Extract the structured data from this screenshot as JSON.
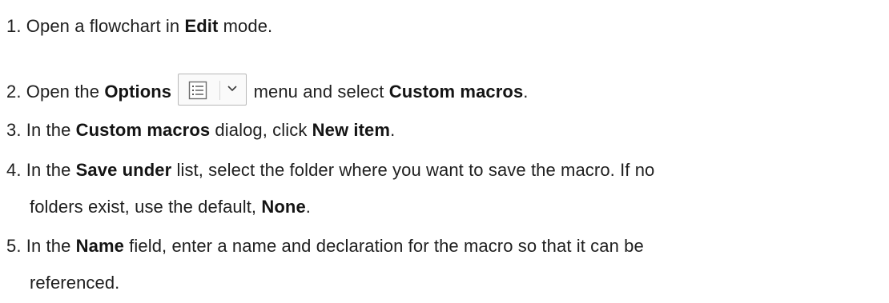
{
  "steps": [
    {
      "num": "1.",
      "t1": " Open a flowchart in ",
      "b1": "Edit",
      "t2": " mode."
    },
    {
      "num": "2.",
      "t1": " Open the ",
      "b1": "Options",
      "icon": "options-menu-icon",
      "t2": " menu and select ",
      "b2": "Custom macros",
      "t3": "."
    },
    {
      "num": "3.",
      "t1": " In the ",
      "b1": "Custom macros",
      "t2": " dialog, click ",
      "b2": "New item",
      "t3": "."
    },
    {
      "num": "4.",
      "t1": " In the ",
      "b1": "Save under",
      "t2": " list, select the folder where you want to save the macro. If no",
      "cont_t1": "folders exist, use the default, ",
      "cont_b1": "None",
      "cont_t2": "."
    },
    {
      "num": "5.",
      "t1": " In the ",
      "b1": "Name",
      "t2": " field, enter a name and declaration for the macro so that it can be",
      "cont_t1": "referenced."
    }
  ],
  "colors": {
    "text": "#1f1f1f",
    "icon_border": "#b8b8b8"
  }
}
